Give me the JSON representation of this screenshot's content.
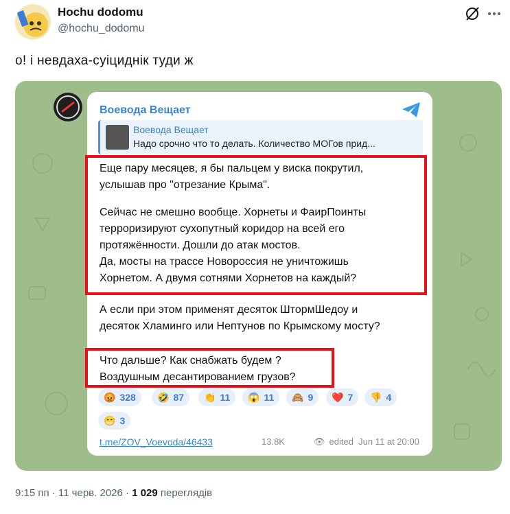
{
  "tweet": {
    "author_name": "Hochu dodomu",
    "author_handle": "@hochu_dodomu",
    "text": "о!  і  невдаха-суіциднік  туди  ж"
  },
  "media": {
    "channel_title": "Воевода Вещает",
    "reply": {
      "name": "Воевода Вещает",
      "text": "Надо срочно что то делать. Количество МОГов прид..."
    },
    "paragraph1": "Еще пару месяцев, я бы пальцем у виска покрутил,\nуслышав про \"отрезание Крыма\".",
    "paragraph2": "Сейчас не смешно вообще. Хорнеты и ФаирПоинты\nтерроризируют сухопутный коридор на всей его\nпротяжённости. Дошли до атак мостов.\nДа, мосты на трассе Новороссия не уничтожишь\nХорнетом. А двумя сотнями Хорнетов на каждый?",
    "paragraph3": "А если при этом применят десяток ШтормШедоу и\nдесяток Хламинго или Нептунов по Крымскому мосту?",
    "paragraph4": "Что дальше? Как снабжать будем ?\nВоздушным десантированием грузов?",
    "reactions": [
      {
        "emoji": "😡",
        "count": "328"
      },
      {
        "emoji": "🤣",
        "count": "87"
      },
      {
        "emoji": "👏",
        "count": "11"
      },
      {
        "emoji": "😱",
        "count": "11"
      },
      {
        "emoji": "🙈",
        "count": "9"
      },
      {
        "emoji": "❤️",
        "count": "7"
      },
      {
        "emoji": "👎",
        "count": "4"
      },
      {
        "emoji": "😁",
        "count": "3"
      }
    ],
    "link": "t.me/ZOV_Voevoda/46433",
    "views": "13.8K",
    "edited_label": "edited",
    "date": "Jun 11 at 20:00"
  },
  "footer": {
    "time_date": "9:15 пп · 11 черв. 2026 · ",
    "views_count": "1 029",
    "views_label": " переглядів"
  },
  "colors": {
    "accent": "#3b84c7",
    "highlight": "#e5121a",
    "chat_bg": "#9fbd8a"
  }
}
